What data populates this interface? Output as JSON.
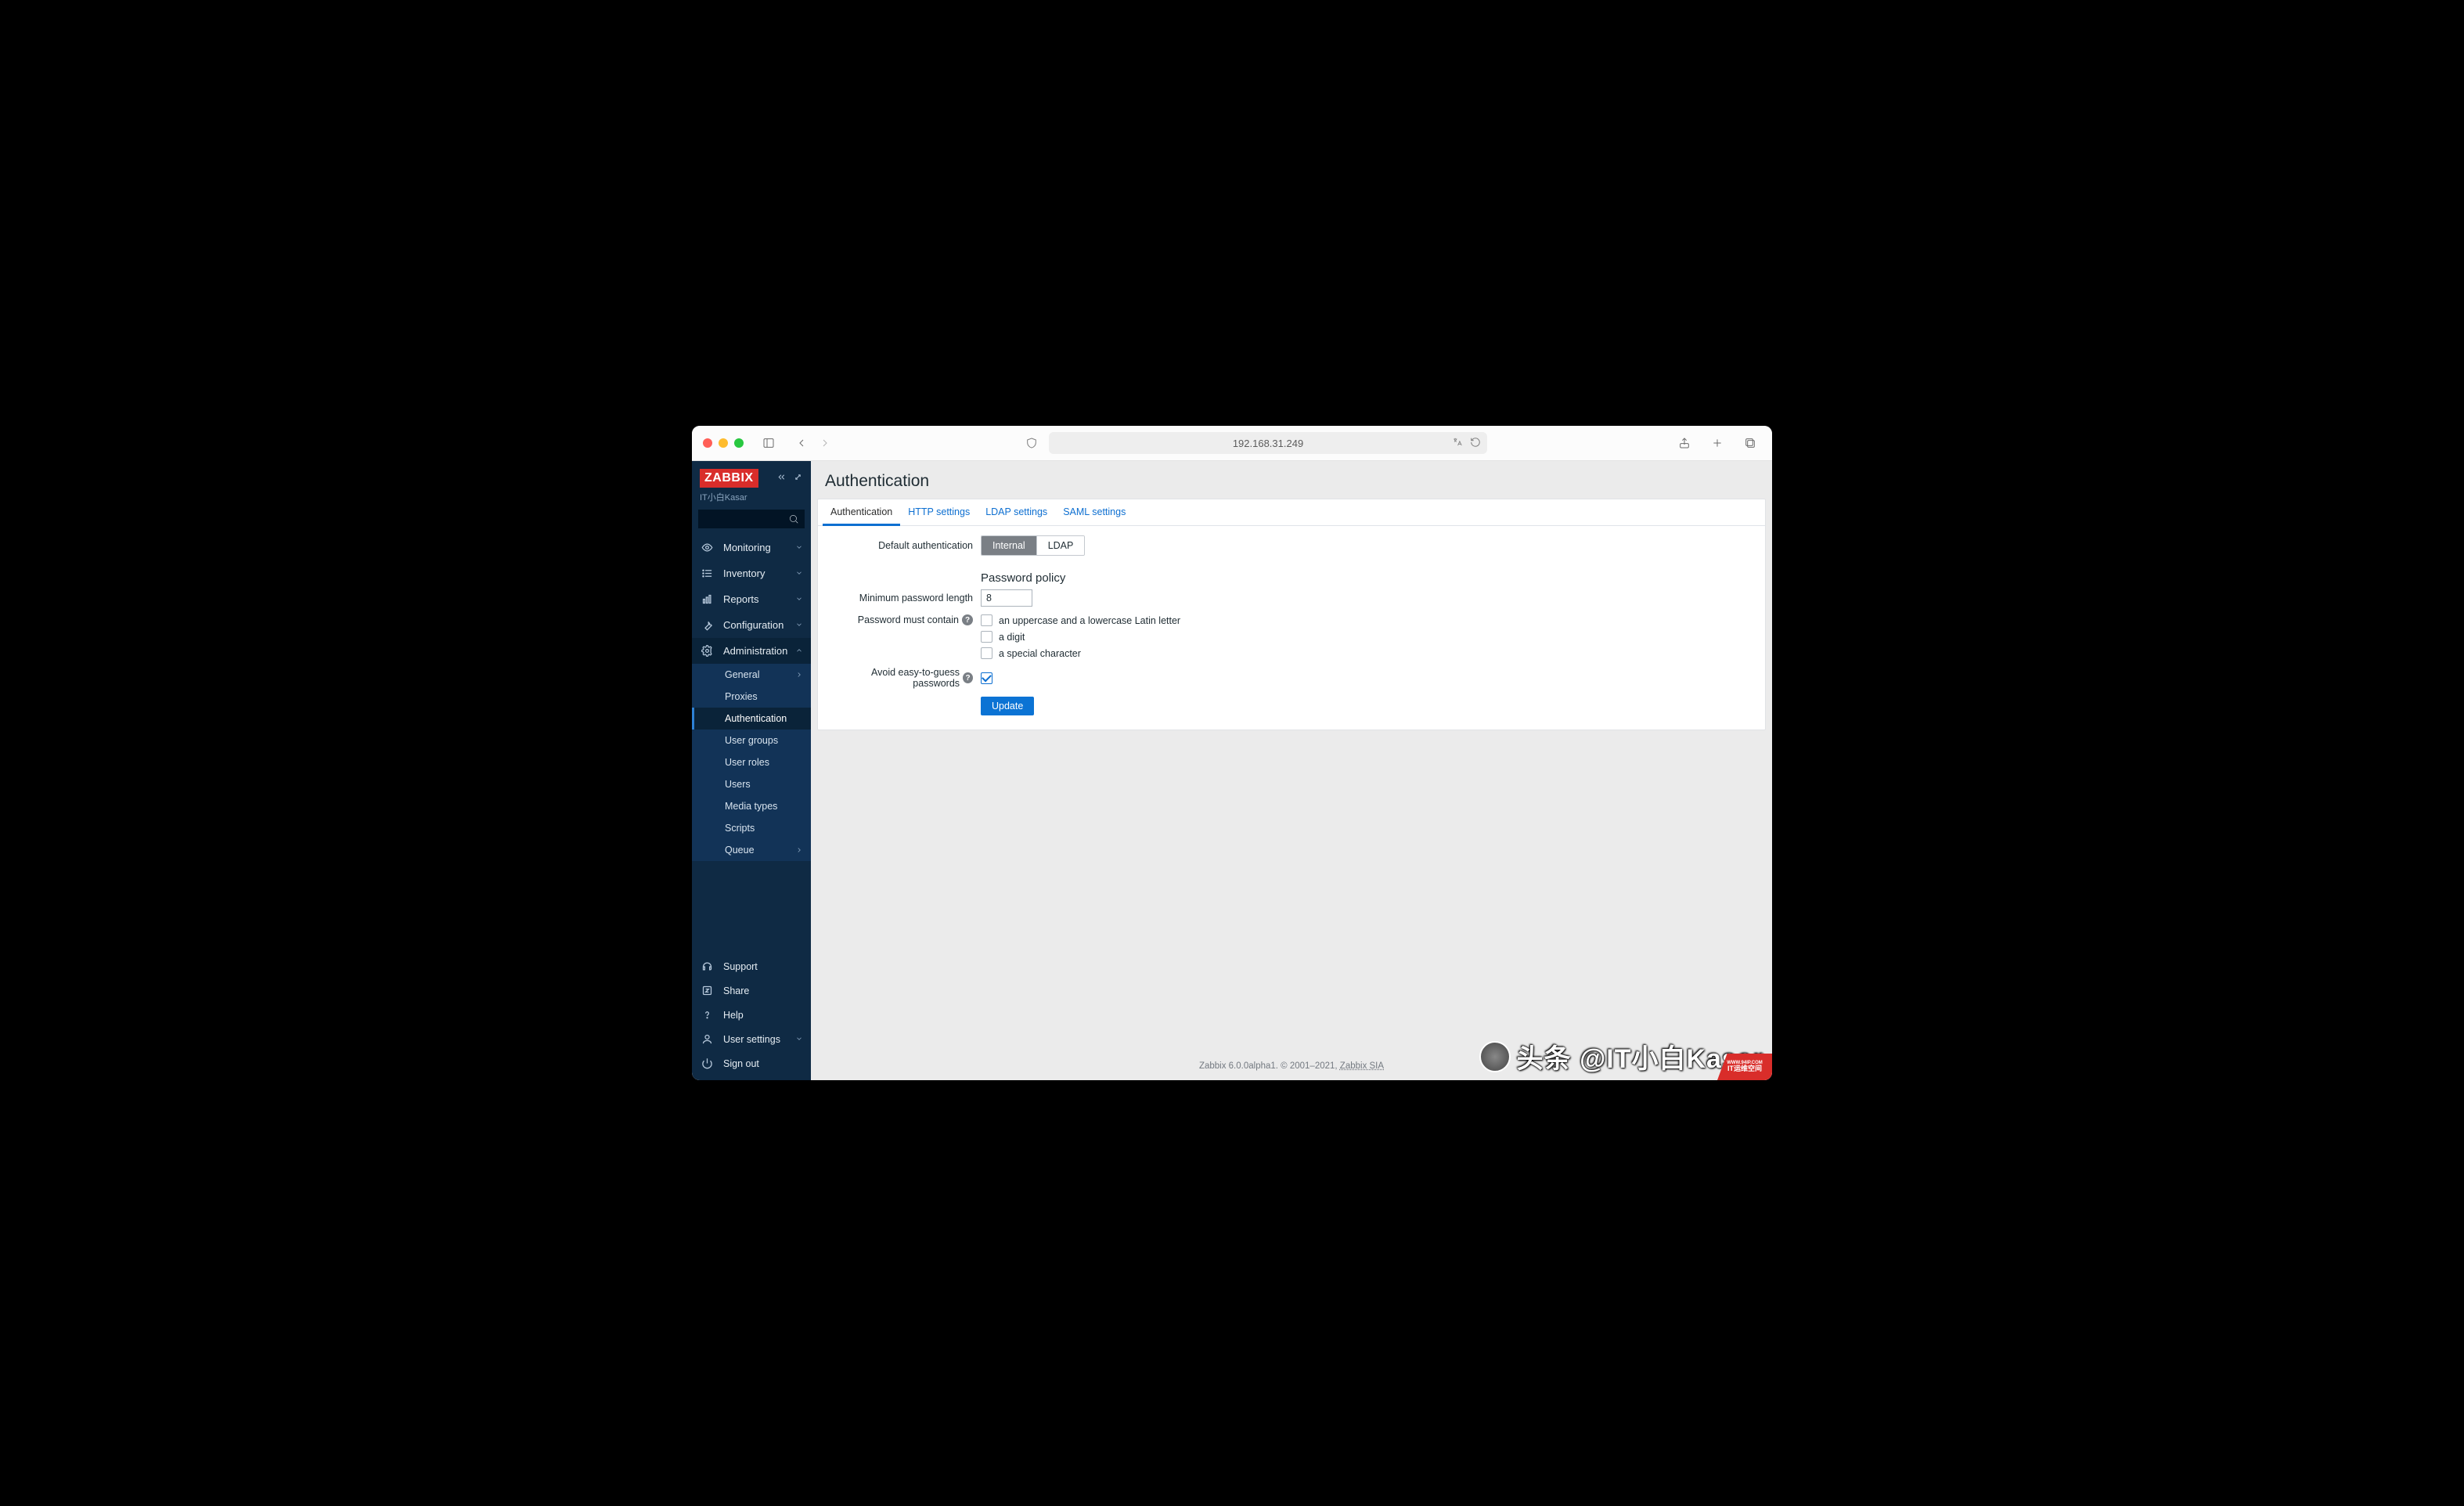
{
  "browser": {
    "url": "192.168.31.249"
  },
  "sidebar": {
    "logo": "ZABBIX",
    "server_name": "IT小白Kasar",
    "nav": [
      {
        "label": "Monitoring"
      },
      {
        "label": "Inventory"
      },
      {
        "label": "Reports"
      },
      {
        "label": "Configuration"
      },
      {
        "label": "Administration"
      }
    ],
    "admin_sub": [
      {
        "label": "General"
      },
      {
        "label": "Proxies"
      },
      {
        "label": "Authentication"
      },
      {
        "label": "User groups"
      },
      {
        "label": "User roles"
      },
      {
        "label": "Users"
      },
      {
        "label": "Media types"
      },
      {
        "label": "Scripts"
      },
      {
        "label": "Queue"
      }
    ],
    "footer": [
      {
        "label": "Support"
      },
      {
        "label": "Share"
      },
      {
        "label": "Help"
      },
      {
        "label": "User settings"
      },
      {
        "label": "Sign out"
      }
    ]
  },
  "page": {
    "title": "Authentication",
    "tabs": [
      {
        "label": "Authentication"
      },
      {
        "label": "HTTP settings"
      },
      {
        "label": "LDAP settings"
      },
      {
        "label": "SAML settings"
      }
    ],
    "form": {
      "default_auth_label": "Default authentication",
      "default_auth_options": {
        "internal": "Internal",
        "ldap": "LDAP"
      },
      "password_policy_title": "Password policy",
      "min_len_label": "Minimum password length",
      "min_len_value": "8",
      "must_contain_label": "Password must contain",
      "must_contain_options": {
        "upper_lower": "an uppercase and a lowercase Latin letter",
        "digit": "a digit",
        "special": "a special character"
      },
      "avoid_easy_label": "Avoid easy-to-guess passwords",
      "update_btn": "Update"
    },
    "footer": {
      "text": "Zabbix 6.0.0alpha1. © 2001–2021, ",
      "link": "Zabbix SIA"
    }
  },
  "watermark": "头条 @IT小白Kasar",
  "badge": {
    "line1": "WWW.94IP.COM",
    "line2": "IT运维空间"
  }
}
